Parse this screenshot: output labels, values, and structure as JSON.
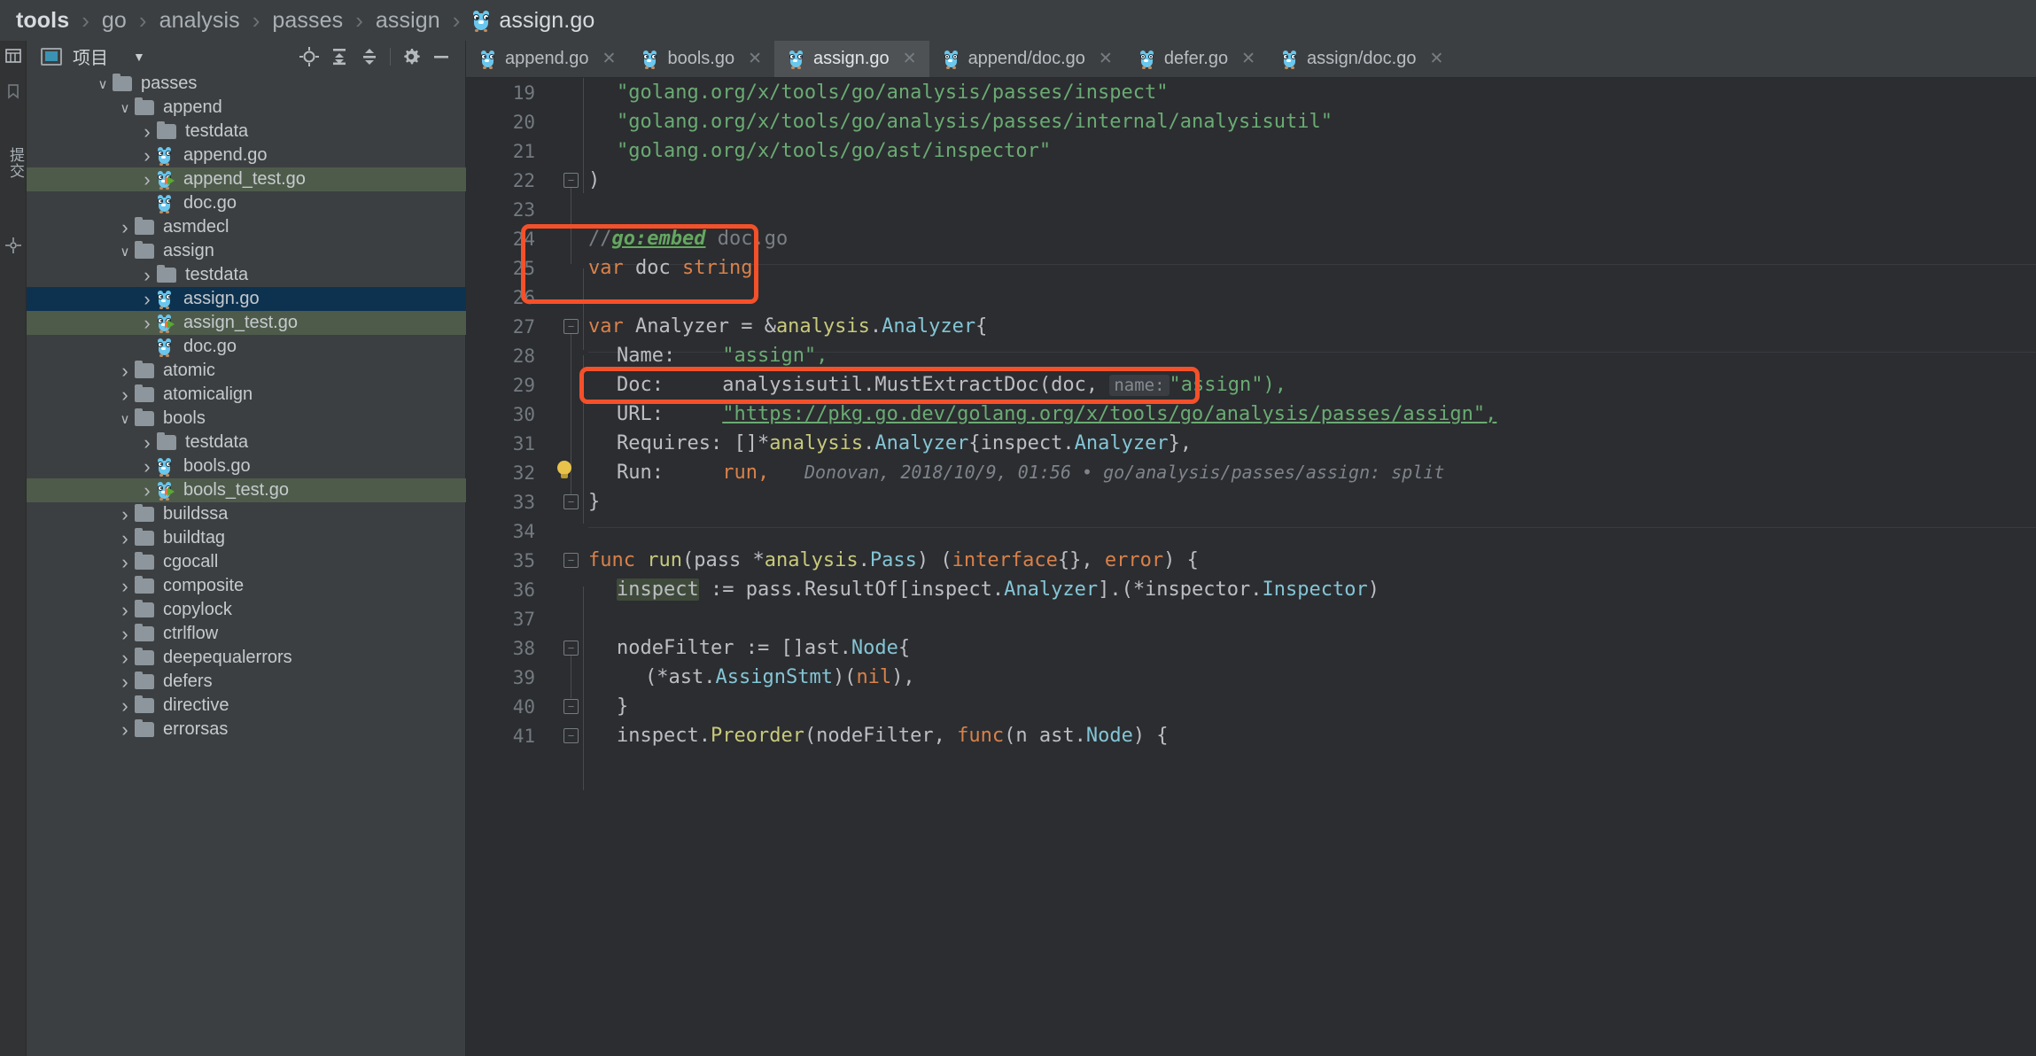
{
  "breadcrumb": {
    "items": [
      "tools",
      "go",
      "analysis",
      "passes",
      "assign",
      "assign.go"
    ],
    "separator": "›"
  },
  "rail": {
    "vertical_label": "提交",
    "icons": [
      "table-icon",
      "bookmark-icon",
      "commit-icon",
      "structure-icon"
    ]
  },
  "project_panel": {
    "title": "项目",
    "dropdown_icon": "chevron-down-icon",
    "toolbar": [
      {
        "name": "locate-file-icon",
        "label": "⊕"
      },
      {
        "name": "expand-all-icon",
        "label": "⤓"
      },
      {
        "name": "collapse-all-icon",
        "label": "⤒"
      },
      {
        "name": "settings-gear-icon",
        "label": "⚙"
      },
      {
        "name": "hide-panel-icon",
        "label": "—"
      }
    ],
    "tree": [
      {
        "label": "passes",
        "indent": 3,
        "type": "folder",
        "chevron": "down",
        "state": "normal"
      },
      {
        "label": "append",
        "indent": 4,
        "type": "folder",
        "chevron": "down",
        "state": "normal"
      },
      {
        "label": "testdata",
        "indent": 5,
        "type": "folder",
        "chevron": "right",
        "state": "normal"
      },
      {
        "label": "append.go",
        "indent": 5,
        "type": "go",
        "chevron": "right",
        "state": "normal"
      },
      {
        "label": "append_test.go",
        "indent": 5,
        "type": "gotest",
        "chevron": "right",
        "state": "test"
      },
      {
        "label": "doc.go",
        "indent": 5,
        "type": "go",
        "chevron": "blank",
        "state": "normal"
      },
      {
        "label": "asmdecl",
        "indent": 4,
        "type": "folder",
        "chevron": "right",
        "state": "normal"
      },
      {
        "label": "assign",
        "indent": 4,
        "type": "folder",
        "chevron": "down",
        "state": "normal"
      },
      {
        "label": "testdata",
        "indent": 5,
        "type": "folder",
        "chevron": "right",
        "state": "normal"
      },
      {
        "label": "assign.go",
        "indent": 5,
        "type": "go",
        "chevron": "right",
        "state": "selected"
      },
      {
        "label": "assign_test.go",
        "indent": 5,
        "type": "gotest",
        "chevron": "right",
        "state": "test"
      },
      {
        "label": "doc.go",
        "indent": 5,
        "type": "go",
        "chevron": "blank",
        "state": "normal"
      },
      {
        "label": "atomic",
        "indent": 4,
        "type": "folder",
        "chevron": "right",
        "state": "normal"
      },
      {
        "label": "atomicalign",
        "indent": 4,
        "type": "folder",
        "chevron": "right",
        "state": "normal"
      },
      {
        "label": "bools",
        "indent": 4,
        "type": "folder",
        "chevron": "down",
        "state": "normal"
      },
      {
        "label": "testdata",
        "indent": 5,
        "type": "folder",
        "chevron": "right",
        "state": "normal"
      },
      {
        "label": "bools.go",
        "indent": 5,
        "type": "go",
        "chevron": "right",
        "state": "normal"
      },
      {
        "label": "bools_test.go",
        "indent": 5,
        "type": "gotest",
        "chevron": "right",
        "state": "test"
      },
      {
        "label": "buildssa",
        "indent": 4,
        "type": "folder",
        "chevron": "right",
        "state": "normal"
      },
      {
        "label": "buildtag",
        "indent": 4,
        "type": "folder",
        "chevron": "right",
        "state": "normal"
      },
      {
        "label": "cgocall",
        "indent": 4,
        "type": "folder",
        "chevron": "right",
        "state": "normal"
      },
      {
        "label": "composite",
        "indent": 4,
        "type": "folder",
        "chevron": "right",
        "state": "normal"
      },
      {
        "label": "copylock",
        "indent": 4,
        "type": "folder",
        "chevron": "right",
        "state": "normal"
      },
      {
        "label": "ctrlflow",
        "indent": 4,
        "type": "folder",
        "chevron": "right",
        "state": "normal"
      },
      {
        "label": "deepequalerrors",
        "indent": 4,
        "type": "folder",
        "chevron": "right",
        "state": "normal"
      },
      {
        "label": "defers",
        "indent": 4,
        "type": "folder",
        "chevron": "right",
        "state": "normal"
      },
      {
        "label": "directive",
        "indent": 4,
        "type": "folder",
        "chevron": "right",
        "state": "normal"
      },
      {
        "label": "errorsas",
        "indent": 4,
        "type": "folder",
        "chevron": "right",
        "state": "normal"
      }
    ]
  },
  "editor": {
    "tabs": [
      {
        "label": "append.go",
        "active": false,
        "icon": "go-file-icon",
        "close": "✕"
      },
      {
        "label": "bools.go",
        "active": false,
        "icon": "go-file-icon",
        "close": "✕"
      },
      {
        "label": "assign.go",
        "active": true,
        "icon": "go-file-icon",
        "close": "✕"
      },
      {
        "label": "append/doc.go",
        "active": false,
        "icon": "go-file-icon",
        "close": "✕"
      },
      {
        "label": "defer.go",
        "active": false,
        "icon": "go-file-icon",
        "close": "✕"
      },
      {
        "label": "assign/doc.go",
        "active": false,
        "icon": "go-file-icon",
        "close": "✕"
      }
    ],
    "first_line_number": 19,
    "lines": [
      {
        "n": 19,
        "indent": 1
      },
      {
        "n": 20,
        "indent": 1
      },
      {
        "n": 21,
        "indent": 1
      },
      {
        "n": 22,
        "indent": 0
      },
      {
        "n": 23,
        "indent": 0
      },
      {
        "n": 24,
        "indent": 0
      },
      {
        "n": 25,
        "indent": 0
      },
      {
        "n": 26,
        "indent": 0
      },
      {
        "n": 27,
        "indent": 0
      },
      {
        "n": 28,
        "indent": 1
      },
      {
        "n": 29,
        "indent": 1
      },
      {
        "n": 30,
        "indent": 1
      },
      {
        "n": 31,
        "indent": 1
      },
      {
        "n": 32,
        "indent": 1
      },
      {
        "n": 33,
        "indent": 0
      },
      {
        "n": 34,
        "indent": 0
      },
      {
        "n": 35,
        "indent": 0
      },
      {
        "n": 36,
        "indent": 1
      },
      {
        "n": 37,
        "indent": 0
      },
      {
        "n": 38,
        "indent": 1
      },
      {
        "n": 39,
        "indent": 2
      },
      {
        "n": 40,
        "indent": 1
      },
      {
        "n": 41,
        "indent": 1
      }
    ],
    "code": {
      "l19": "\"golang.org/x/tools/go/analysis/passes/inspect\"",
      "l20": "\"golang.org/x/tools/go/analysis/passes/internal/analysisutil\"",
      "l21": "\"golang.org/x/tools/go/ast/inspector\"",
      "l22": ")",
      "l24_comment": "//",
      "l24_embed": "go:embed",
      "l24_rest": " doc.go",
      "l25_kw": "var",
      "l25_name": " doc ",
      "l25_type": "string",
      "l27": "var Analyzer = &analysis.Analyzer{",
      "l28_key": "Name:",
      "l28_val": "\"assign\",",
      "l29_key": "Doc:",
      "l29_call": "analysisutil.MustExtractDoc(doc,",
      "l29_hint": "name:",
      "l29_arg": "\"assign\"),",
      "l30_key": "URL:",
      "l30_val": "\"https://pkg.go.dev/golang.org/x/tools/go/analysis/passes/assign\",",
      "l31_key": "Requires:",
      "l31_val": "[]*analysis.Analyzer{inspect.Analyzer},",
      "l32_key": "Run:",
      "l32_val": "run,",
      "l32_annotation": "Donovan, 2018/10/9, 01:56 • go/analysis/passes/assign: split",
      "l33": "}",
      "l35": "func run(pass *analysis.Pass) (interface{}, error) {",
      "l36_ident": "inspect",
      "l36_rest": " := pass.ResultOf[inspect.Analyzer].(*inspector.Inspector)",
      "l38": "nodeFilter := []ast.Node{",
      "l39": "(*ast.AssignStmt)(nil),",
      "l40": "}",
      "l41": "inspect.Preorder(nodeFilter, func(n ast.Node) {"
    },
    "gutter_icons": [
      {
        "name": "lightbulb-icon",
        "line": 32
      }
    ],
    "annotations": [
      {
        "name": "highlight-box-embed",
        "target_lines": "24-25"
      },
      {
        "name": "highlight-box-doc",
        "target_lines": "29"
      }
    ]
  },
  "colors": {
    "accent_red": "#f4502a",
    "selection_blue": "#0d3250",
    "test_green": "#4e5b4b",
    "editor_bg": "#2b2d30",
    "panel_bg": "#3c3f41",
    "keyword": "#d9814a",
    "string": "#6aab73",
    "type": "#84c5d6",
    "function": "#c9c97c"
  }
}
